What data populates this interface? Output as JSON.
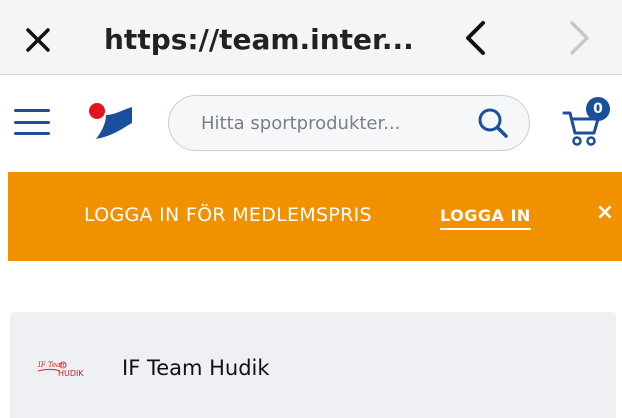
{
  "browser": {
    "url": "https://team.inter...",
    "icons": {
      "close": "close-icon",
      "back": "chevron-left-icon",
      "forward": "chevron-right-icon"
    }
  },
  "header": {
    "search_placeholder": "Hitta sportprodukter...",
    "cart_count": "0",
    "icons": {
      "menu": "hamburger-menu-icon",
      "logo": "intersport-logo",
      "search": "search-icon",
      "cart": "cart-icon"
    }
  },
  "promo": {
    "text": "LOGGA IN FÖR MEDLEMSPRIS",
    "link": "LOGGA IN",
    "close": "×"
  },
  "team": {
    "name": "IF Team Hudik",
    "logo_text": "HUDIK"
  },
  "colors": {
    "brand_blue": "#1b4f9b",
    "promo_orange": "#f29100",
    "logo_red": "#e2141f"
  }
}
